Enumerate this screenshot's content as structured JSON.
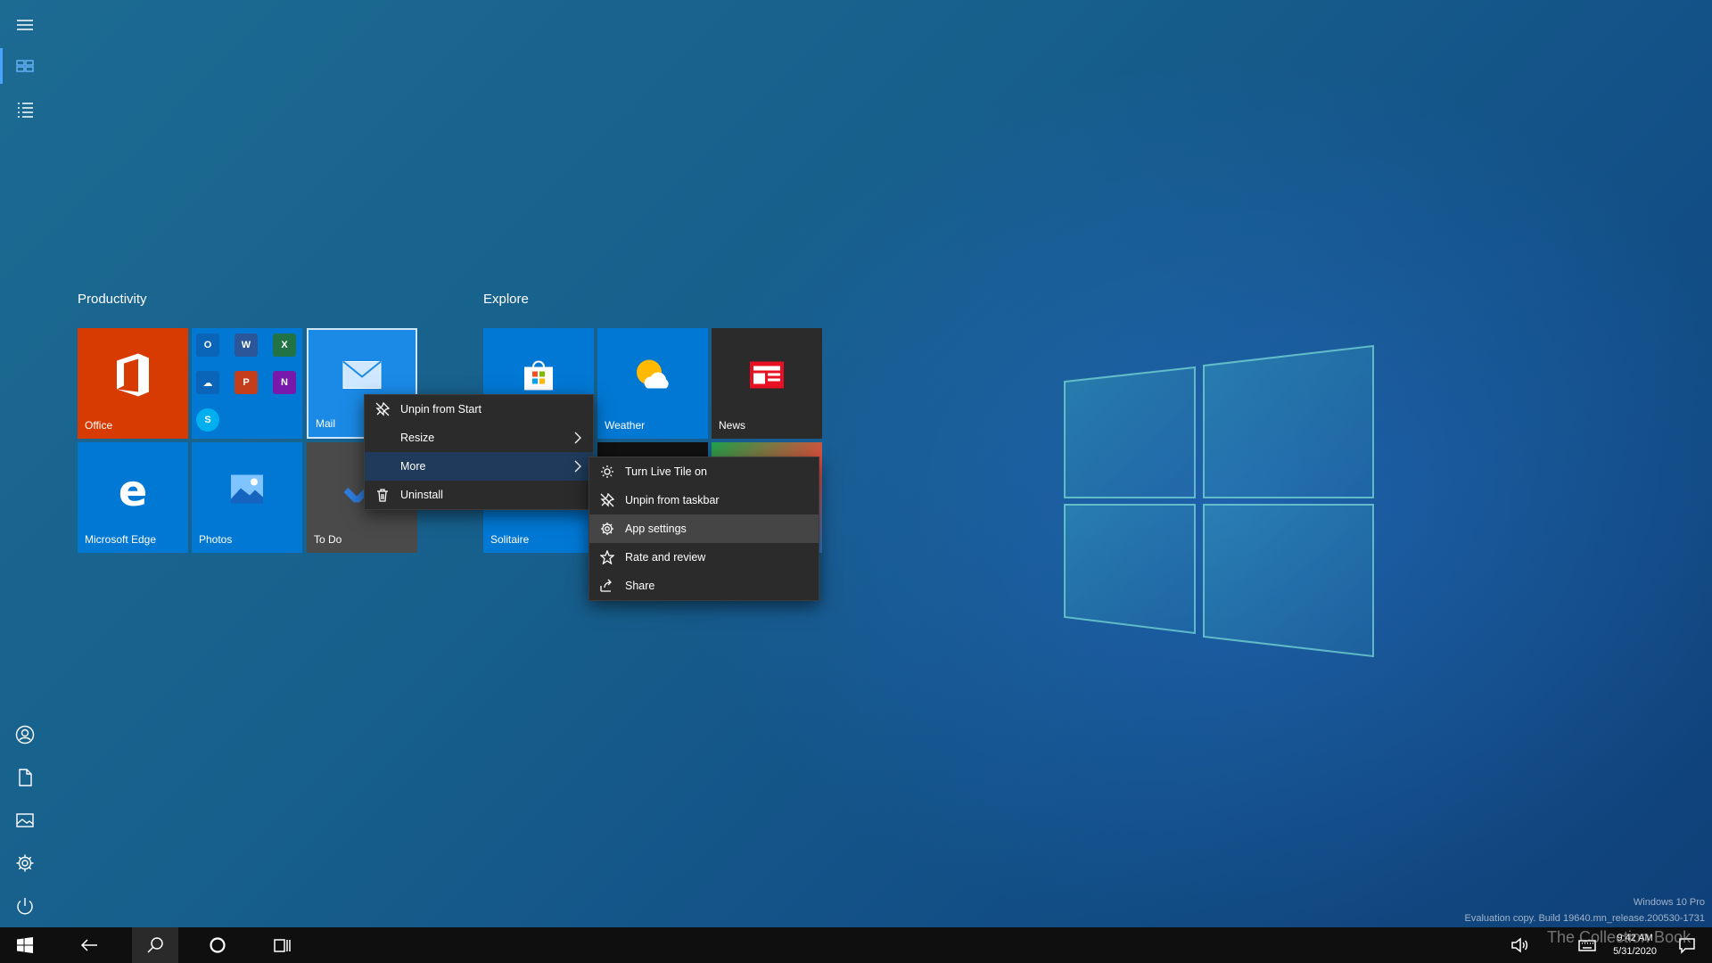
{
  "rail": {
    "icons": [
      "hamburger-icon",
      "tiles-icon",
      "all-apps-icon",
      "user-icon",
      "documents-icon",
      "pictures-icon",
      "settings-icon",
      "power-icon"
    ]
  },
  "groups": {
    "productivity": {
      "title": "Productivity",
      "tiles": {
        "office": {
          "label": "Office",
          "color": "#d83b01"
        },
        "office_folder": {
          "color": "#0078d4"
        },
        "mail": {
          "label": "Mail",
          "color": "#1a8ae6"
        },
        "edge": {
          "label": "Microsoft Edge",
          "color": "#0078d4"
        },
        "photos": {
          "label": "Photos",
          "color": "#0078d4"
        },
        "todo": {
          "label": "To Do",
          "color": "#4a4a4a"
        }
      }
    },
    "explore": {
      "title": "Explore",
      "tiles": {
        "store": {
          "label": "",
          "color": "#0078d4"
        },
        "weather": {
          "label": "Weather",
          "color": "#0078d4"
        },
        "news": {
          "label": "News",
          "color": "#2b2b2b"
        },
        "solitaire": {
          "label": "Solitaire",
          "color": "#0078d4"
        }
      }
    }
  },
  "context_menu": {
    "items": [
      {
        "label": "Unpin from Start",
        "icon": "unpin-icon"
      },
      {
        "label": "Resize",
        "icon": "",
        "submenu": true
      },
      {
        "label": "More",
        "icon": "",
        "submenu": true
      },
      {
        "label": "Uninstall",
        "icon": "trash-icon"
      }
    ]
  },
  "sub_menu": {
    "items": [
      {
        "label": "Turn Live Tile on",
        "icon": "brightness-icon"
      },
      {
        "label": "Unpin from taskbar",
        "icon": "unpin-icon"
      },
      {
        "label": "App settings",
        "icon": "gear-icon"
      },
      {
        "label": "Rate and review",
        "icon": "star-icon"
      },
      {
        "label": "Share",
        "icon": "share-icon"
      }
    ]
  },
  "taskbar": {
    "time": "9:42 AM",
    "date": "5/31/2020"
  },
  "watermark": {
    "line1": "Windows 10 Pro",
    "line2": "Evaluation copy. Build 19640.mn_release.200530-1731"
  },
  "brand": "The Collection Book"
}
